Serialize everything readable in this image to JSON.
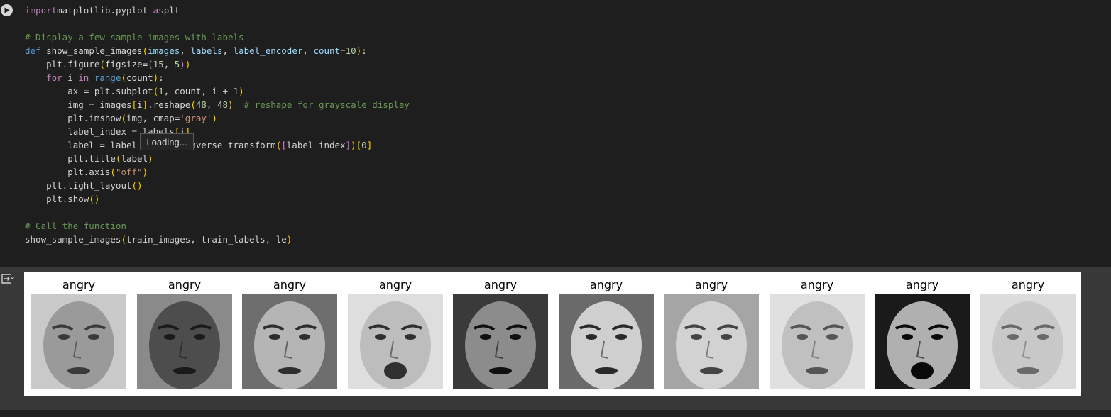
{
  "code_lines": [
    [
      [
        "kw",
        "import"
      ],
      [
        "",
        "matplotlib.pyplot "
      ],
      [
        "kw",
        "as"
      ],
      [
        "",
        "plt"
      ]
    ],
    [],
    [
      [
        "cm",
        "# Display a few sample images with labels"
      ]
    ],
    [
      [
        "dk",
        "def "
      ],
      [
        "",
        "show_sample_images"
      ],
      [
        "pn",
        "("
      ],
      [
        "ar",
        "images"
      ],
      [
        "",
        ", "
      ],
      [
        "ar",
        "labels"
      ],
      [
        "",
        ", "
      ],
      [
        "ar",
        "label_encoder"
      ],
      [
        "",
        ", "
      ],
      [
        "ar",
        "count"
      ],
      [
        "",
        "="
      ],
      [
        "nm",
        "10"
      ],
      [
        "pn",
        ")"
      ],
      [
        "",
        ":"
      ]
    ],
    [
      [
        "",
        "    plt.figure"
      ],
      [
        "pn",
        "("
      ],
      [
        "",
        "figsize="
      ],
      [
        "pn2",
        "("
      ],
      [
        "nm",
        "15"
      ],
      [
        "",
        ", "
      ],
      [
        "nm",
        "5"
      ],
      [
        "pn2",
        ")"
      ],
      [
        "pn",
        ")"
      ]
    ],
    [
      [
        "kw",
        "    for "
      ],
      [
        "",
        "i "
      ],
      [
        "kw",
        "in "
      ],
      [
        "dk",
        "range"
      ],
      [
        "pn",
        "("
      ],
      [
        "",
        "count"
      ],
      [
        "pn",
        ")"
      ],
      [
        "",
        ":"
      ]
    ],
    [
      [
        "",
        "        ax = plt.subplot"
      ],
      [
        "pn",
        "("
      ],
      [
        "nm",
        "1"
      ],
      [
        "",
        ", count, i + "
      ],
      [
        "nm",
        "1"
      ],
      [
        "pn",
        ")"
      ]
    ],
    [
      [
        "",
        "        img = images"
      ],
      [
        "pn",
        "["
      ],
      [
        "",
        "i"
      ],
      [
        "pn",
        "]"
      ],
      [
        "",
        ".reshape"
      ],
      [
        "pn",
        "("
      ],
      [
        "nm",
        "48"
      ],
      [
        "",
        ", "
      ],
      [
        "nm",
        "48"
      ],
      [
        "pn",
        ")"
      ],
      [
        "",
        "  "
      ],
      [
        "cm",
        "# reshape for grayscale display"
      ]
    ],
    [
      [
        "",
        "        plt.imshow"
      ],
      [
        "pn",
        "("
      ],
      [
        "",
        "img, cmap="
      ],
      [
        "st",
        "'gray'"
      ],
      [
        "pn",
        ")"
      ]
    ],
    [
      [
        "",
        "        label_index = labels"
      ],
      [
        "pn",
        "["
      ],
      [
        "",
        "i"
      ],
      [
        "pn",
        "]"
      ]
    ],
    [
      [
        "",
        "        label = label_encoder.inverse_transform"
      ],
      [
        "pn",
        "("
      ],
      [
        "pn2",
        "["
      ],
      [
        "",
        "label_index"
      ],
      [
        "pn2",
        "]"
      ],
      [
        "pn",
        ")"
      ],
      [
        "pn",
        "["
      ],
      [
        "nm",
        "0"
      ],
      [
        "pn",
        "]"
      ]
    ],
    [
      [
        "",
        "        plt.title"
      ],
      [
        "pn",
        "("
      ],
      [
        "",
        "label"
      ],
      [
        "pn",
        ")"
      ]
    ],
    [
      [
        "",
        "        plt.axis"
      ],
      [
        "pn",
        "("
      ],
      [
        "st",
        "\"off\""
      ],
      [
        "pn",
        ")"
      ]
    ],
    [
      [
        "",
        "    plt.tight_layout"
      ],
      [
        "pn",
        "()"
      ]
    ],
    [
      [
        "",
        "    plt.show"
      ],
      [
        "pn",
        "()"
      ]
    ],
    [],
    [
      [
        "cm",
        "# Call the function"
      ]
    ],
    [
      [
        "",
        "show_sample_images"
      ],
      [
        "pn",
        "("
      ],
      [
        "",
        "train_images, train_labels, le"
      ],
      [
        "pn",
        ")"
      ]
    ]
  ],
  "tooltip": "Loading...",
  "figure": {
    "titles": [
      "angry",
      "angry",
      "angry",
      "angry",
      "angry",
      "angry",
      "angry",
      "angry",
      "angry",
      "angry"
    ]
  },
  "icons": {
    "run": "play-circle-icon",
    "output": "output-toggle-icon"
  },
  "colors": {
    "background": "#1e1e1e",
    "output_background": "#383838",
    "keyword": "#c586c0",
    "comment": "#6a9955",
    "number": "#b5cea8",
    "string": "#ce9178",
    "bracket": "#ffd700"
  }
}
